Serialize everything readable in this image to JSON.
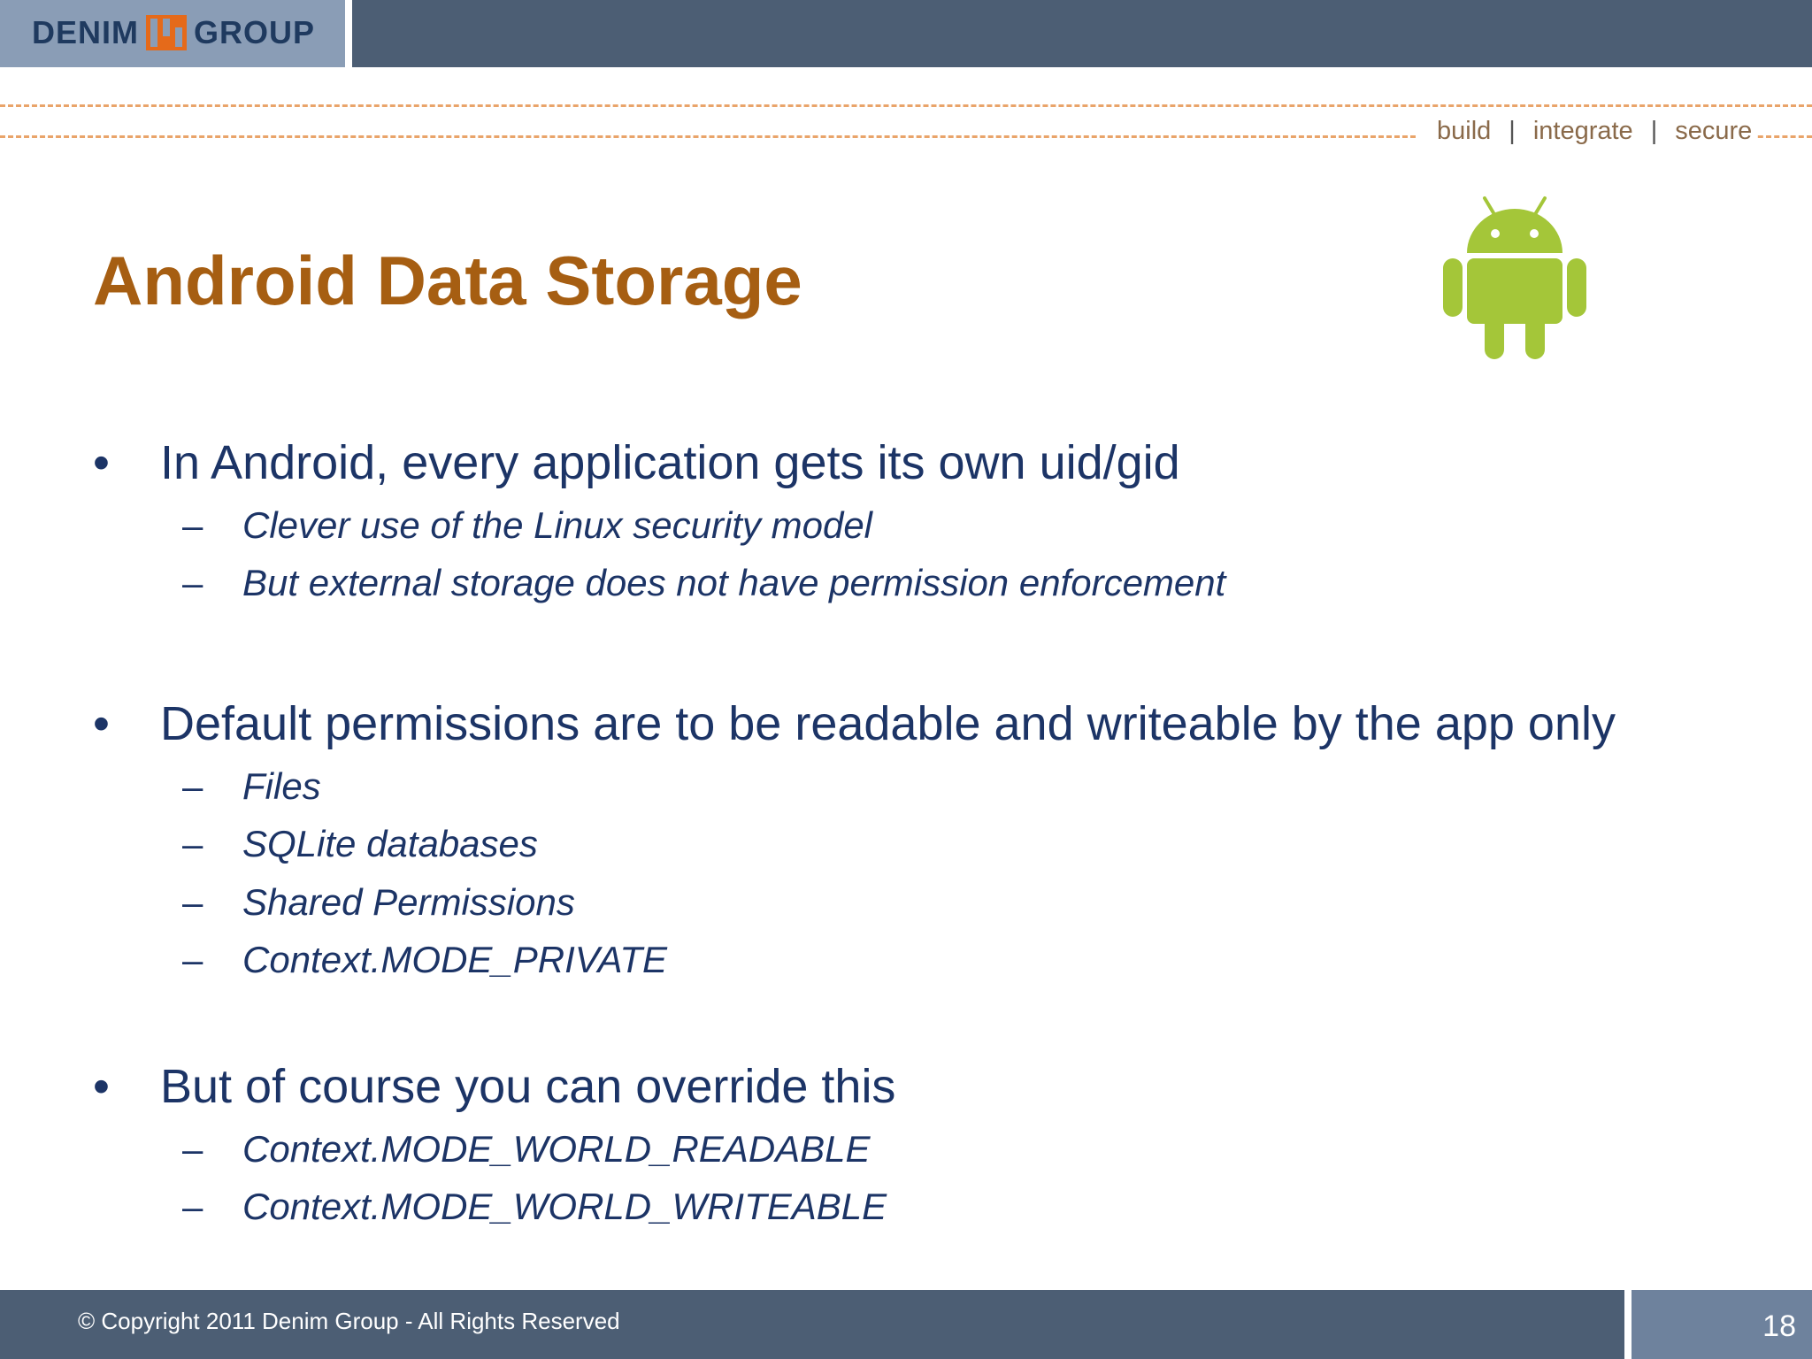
{
  "header": {
    "logo_left": "DENIM",
    "logo_right": "GROUP",
    "tagline": [
      "build",
      "integrate",
      "secure"
    ],
    "tagline_separator": "|"
  },
  "slide": {
    "title": "Android Data Storage",
    "bullets": [
      {
        "text": "In Android, every application gets its own uid/gid",
        "subs": [
          "Clever use of the Linux security model",
          "But external storage does not have permission enforcement"
        ]
      },
      {
        "text": "Default permissions are to be readable and writeable by the app only",
        "subs": [
          "Files",
          "SQLite databases",
          "Shared Permissions",
          "Context.MODE_PRIVATE"
        ]
      },
      {
        "text": "But of course you can override this",
        "subs": [
          "Context.MODE_WORLD_READABLE",
          "Context.MODE_WORLD_WRITEABLE"
        ]
      }
    ],
    "bullet_symbol": "•",
    "sub_symbol": "–"
  },
  "footer": {
    "copyright": "© Copyright 2011 Denim Group - All Rights Reserved",
    "page_number": "18"
  },
  "colors": {
    "title": "#a65e12",
    "body_text": "#1c3466",
    "header_bar": "#4c5e74",
    "accent_dash": "#e9a46a",
    "android_green": "#a4c639"
  },
  "icons": [
    "denim-group-logo",
    "android-robot-icon"
  ]
}
